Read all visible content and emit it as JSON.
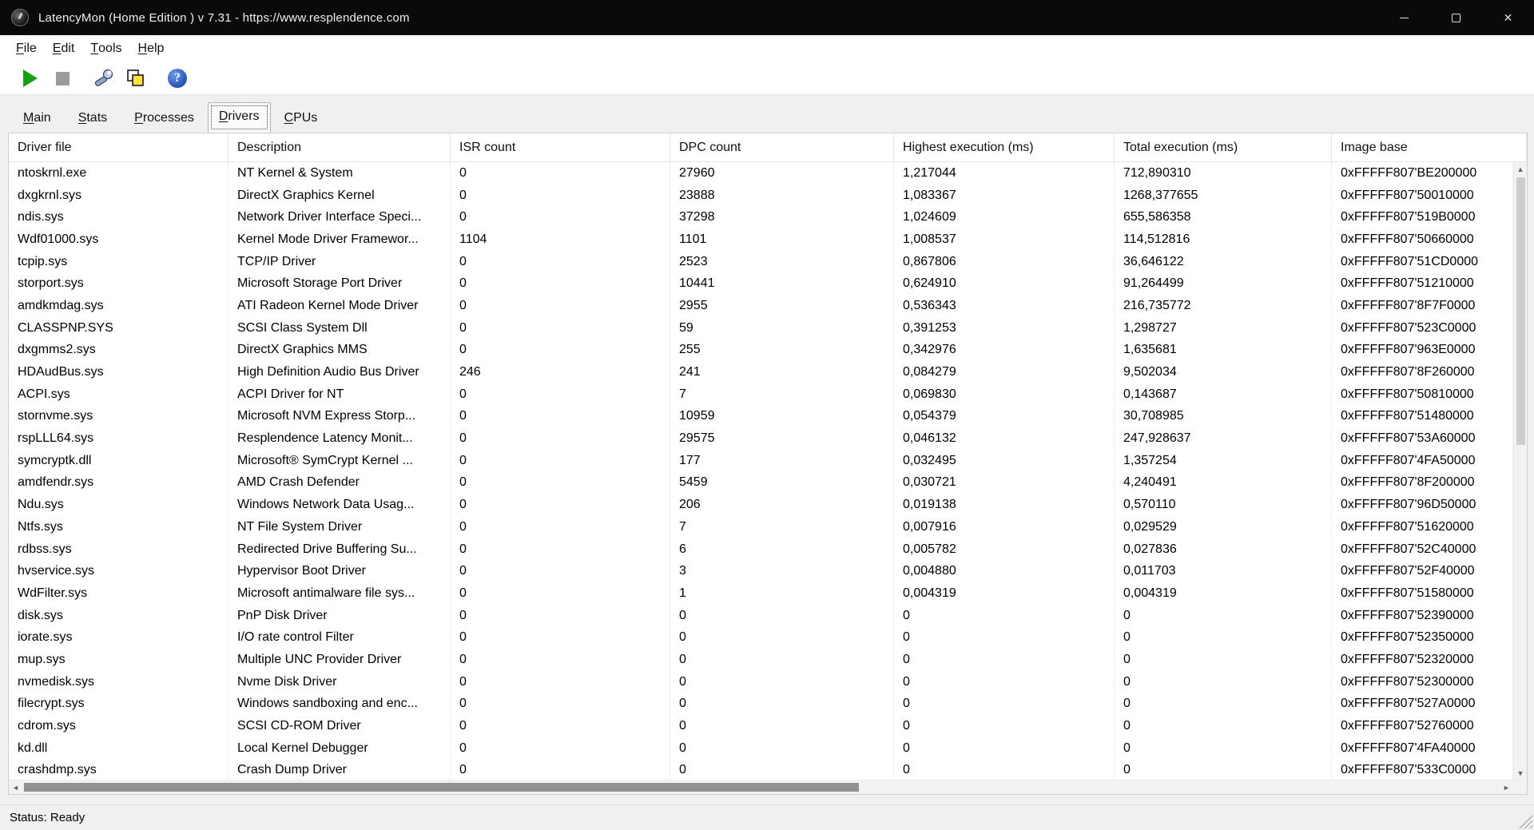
{
  "window": {
    "title": "LatencyMon  (Home Edition )  v 7.31 - https://www.resplendence.com",
    "close_glyph": "✕"
  },
  "menu": {
    "items": [
      "File",
      "Edit",
      "Tools",
      "Help"
    ]
  },
  "toolbar": {
    "help_glyph": "?",
    "icons": [
      {
        "name": "play-icon",
        "color": "#11a211"
      },
      {
        "name": "stop-icon",
        "color": "#9c9c9c"
      },
      {
        "name": "wrench-icon",
        "color": "#7a92b8"
      },
      {
        "name": "report-windows-icon",
        "color": "#ffe13a"
      },
      {
        "name": "help-icon",
        "color": "#1d50b4"
      }
    ]
  },
  "tabs": [
    {
      "label": "Main",
      "active": false
    },
    {
      "label": "Stats",
      "active": false
    },
    {
      "label": "Processes",
      "active": false
    },
    {
      "label": "Drivers",
      "active": true
    },
    {
      "label": "CPUs",
      "active": false
    }
  ],
  "table": {
    "columns": [
      "Driver file",
      "Description",
      "ISR count",
      "DPC count",
      "Highest execution (ms)",
      "Total execution (ms)",
      "Image base"
    ],
    "rows": [
      [
        "ntoskrnl.exe",
        "NT Kernel & System",
        "0",
        "27960",
        "1,217044",
        "712,890310",
        "0xFFFFF807'BE200000"
      ],
      [
        "dxgkrnl.sys",
        "DirectX Graphics Kernel",
        "0",
        "23888",
        "1,083367",
        "1268,377655",
        "0xFFFFF807'50010000"
      ],
      [
        "ndis.sys",
        "Network Driver Interface Speci...",
        "0",
        "37298",
        "1,024609",
        "655,586358",
        "0xFFFFF807'519B0000"
      ],
      [
        "Wdf01000.sys",
        "Kernel Mode Driver Framewor...",
        "1104",
        "1101",
        "1,008537",
        "114,512816",
        "0xFFFFF807'50660000"
      ],
      [
        "tcpip.sys",
        "TCP/IP Driver",
        "0",
        "2523",
        "0,867806",
        "36,646122",
        "0xFFFFF807'51CD0000"
      ],
      [
        "storport.sys",
        "Microsoft Storage Port Driver",
        "0",
        "10441",
        "0,624910",
        "91,264499",
        "0xFFFFF807'51210000"
      ],
      [
        "amdkmdag.sys",
        "ATI Radeon Kernel Mode Driver",
        "0",
        "2955",
        "0,536343",
        "216,735772",
        "0xFFFFF807'8F7F0000"
      ],
      [
        "CLASSPNP.SYS",
        "SCSI Class System Dll",
        "0",
        "59",
        "0,391253",
        "1,298727",
        "0xFFFFF807'523C0000"
      ],
      [
        "dxgmms2.sys",
        "DirectX Graphics MMS",
        "0",
        "255",
        "0,342976",
        "1,635681",
        "0xFFFFF807'963E0000"
      ],
      [
        "HDAudBus.sys",
        "High Definition Audio Bus Driver",
        "246",
        "241",
        "0,084279",
        "9,502034",
        "0xFFFFF807'8F260000"
      ],
      [
        "ACPI.sys",
        "ACPI Driver for NT",
        "0",
        "7",
        "0,069830",
        "0,143687",
        "0xFFFFF807'50810000"
      ],
      [
        "stornvme.sys",
        "Microsoft NVM Express Storp...",
        "0",
        "10959",
        "0,054379",
        "30,708985",
        "0xFFFFF807'51480000"
      ],
      [
        "rspLLL64.sys",
        "Resplendence Latency Monit...",
        "0",
        "29575",
        "0,046132",
        "247,928637",
        "0xFFFFF807'53A60000"
      ],
      [
        "symcryptk.dll",
        "Microsoft® SymCrypt Kernel ...",
        "0",
        "177",
        "0,032495",
        "1,357254",
        "0xFFFFF807'4FA50000"
      ],
      [
        "amdfendr.sys",
        "AMD Crash Defender",
        "0",
        "5459",
        "0,030721",
        "4,240491",
        "0xFFFFF807'8F200000"
      ],
      [
        "Ndu.sys",
        "Windows Network Data Usag...",
        "0",
        "206",
        "0,019138",
        "0,570110",
        "0xFFFFF807'96D50000"
      ],
      [
        "Ntfs.sys",
        "NT File System Driver",
        "0",
        "7",
        "0,007916",
        "0,029529",
        "0xFFFFF807'51620000"
      ],
      [
        "rdbss.sys",
        "Redirected Drive Buffering Su...",
        "0",
        "6",
        "0,005782",
        "0,027836",
        "0xFFFFF807'52C40000"
      ],
      [
        "hvservice.sys",
        "Hypervisor Boot Driver",
        "0",
        "3",
        "0,004880",
        "0,011703",
        "0xFFFFF807'52F40000"
      ],
      [
        "WdFilter.sys",
        "Microsoft antimalware file sys...",
        "0",
        "1",
        "0,004319",
        "0,004319",
        "0xFFFFF807'51580000"
      ],
      [
        "disk.sys",
        "PnP Disk Driver",
        "0",
        "0",
        "0",
        "0",
        "0xFFFFF807'52390000"
      ],
      [
        "iorate.sys",
        "I/O rate control Filter",
        "0",
        "0",
        "0",
        "0",
        "0xFFFFF807'52350000"
      ],
      [
        "mup.sys",
        "Multiple UNC Provider Driver",
        "0",
        "0",
        "0",
        "0",
        "0xFFFFF807'52320000"
      ],
      [
        "nvmedisk.sys",
        "Nvme Disk Driver",
        "0",
        "0",
        "0",
        "0",
        "0xFFFFF807'52300000"
      ],
      [
        "filecrypt.sys",
        "Windows sandboxing and enc...",
        "0",
        "0",
        "0",
        "0",
        "0xFFFFF807'527A0000"
      ],
      [
        "cdrom.sys",
        "SCSI CD-ROM Driver",
        "0",
        "0",
        "0",
        "0",
        "0xFFFFF807'52760000"
      ],
      [
        "kd.dll",
        "Local Kernel Debugger",
        "0",
        "0",
        "0",
        "0",
        "0xFFFFF807'4FA40000"
      ],
      [
        "crashdmp.sys",
        "Crash Dump Driver",
        "0",
        "0",
        "0",
        "0",
        "0xFFFFF807'533C0000"
      ]
    ]
  },
  "scrollbars": {
    "up": "▲",
    "down": "▼",
    "left": "◄",
    "right": "►"
  },
  "statusbar": {
    "text": "Status: Ready"
  }
}
